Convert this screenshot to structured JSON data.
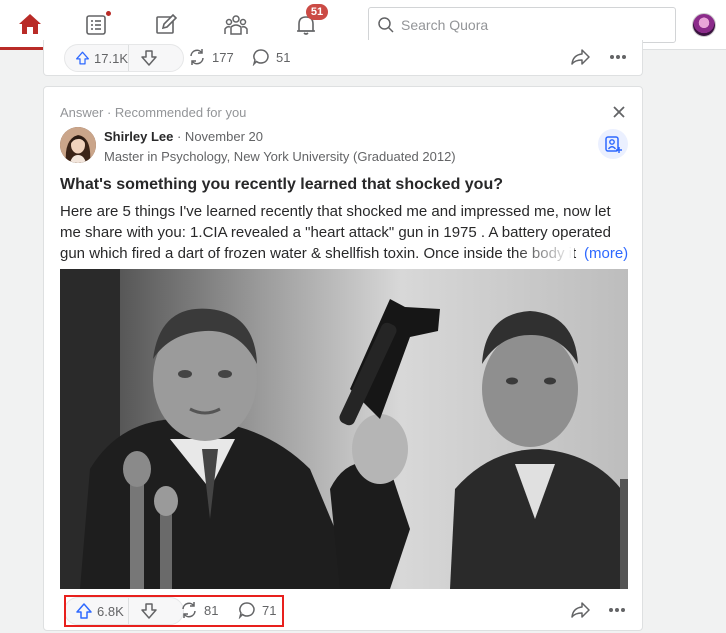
{
  "nav": {
    "icons": [
      "home-icon",
      "following-icon",
      "answer-icon",
      "spaces-icon",
      "notifications-icon"
    ],
    "notification_count": "51",
    "search_placeholder": "Search Quora",
    "accent": "#b92b27"
  },
  "prev_card": {
    "upvotes": "17.1K",
    "shares": "177",
    "comments": "51"
  },
  "card": {
    "meta": "Answer · Recommended for you",
    "author_name": "Shirley Lee",
    "author_date": " · November 20",
    "credential": "Master in Psychology, New York University (Graduated 2012)",
    "question": "What's something you recently learned that shocked you?",
    "answer": "Here are 5 things I've learned recently that shocked me and impressed me, now let me share with you: 1.CIA revealed a \"heart attack\" gun in 1975 . A battery operated gun which fired a dart of frozen water & shellfish toxin. Once inside the body it",
    "more_label": "(more)",
    "upvotes": "6.8K",
    "shares": "81",
    "comments": "71",
    "link_color": "#2e69ff",
    "highlight_color": "#e8201d"
  }
}
